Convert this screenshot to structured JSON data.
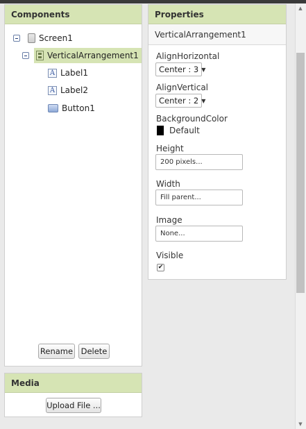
{
  "components": {
    "title": "Components",
    "tree": [
      {
        "name": "Screen1",
        "icon": "screen-icon"
      },
      {
        "name": "VerticalArrangement1",
        "icon": "vertical-arrangement-icon",
        "selected": true
      },
      {
        "name": "Label1",
        "icon": "label-icon",
        "icon_glyph": "A"
      },
      {
        "name": "Label2",
        "icon": "label-icon",
        "icon_glyph": "A"
      },
      {
        "name": "Button1",
        "icon": "button-icon"
      }
    ],
    "rename_label": "Rename",
    "delete_label": "Delete"
  },
  "media": {
    "title": "Media",
    "upload_label": "Upload File ..."
  },
  "properties": {
    "title": "Properties",
    "component_name": "VerticalArrangement1",
    "align_horizontal": {
      "label": "AlignHorizontal",
      "value": "Center : 3"
    },
    "align_vertical": {
      "label": "AlignVertical",
      "value": "Center : 2"
    },
    "background_color": {
      "label": "BackgroundColor",
      "value": "Default",
      "swatch": "#000000"
    },
    "height": {
      "label": "Height",
      "value": "200 pixels..."
    },
    "width": {
      "label": "Width",
      "value": "Fill parent..."
    },
    "image": {
      "label": "Image",
      "value": "None..."
    },
    "visible": {
      "label": "Visible",
      "checked": true,
      "check_glyph": "✔"
    }
  },
  "colors": {
    "panel_header": "#d6e4b4",
    "selected_row": "#d6e4b4"
  }
}
